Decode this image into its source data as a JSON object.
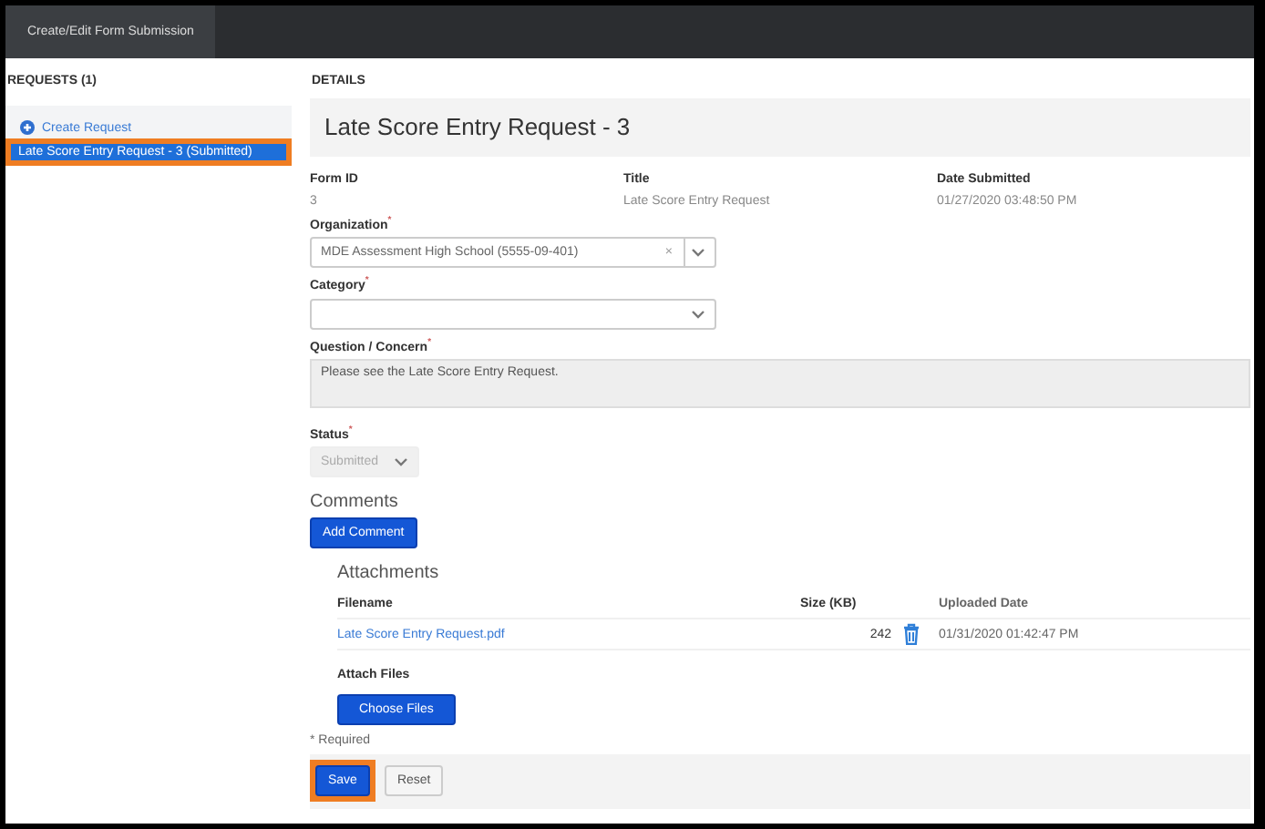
{
  "top_tab": {
    "label": "Create/Edit Form Submission",
    "selected": true
  },
  "requests": {
    "heading": "REQUESTS (1)",
    "create": "Create Request",
    "items": [
      {
        "label": "Late Score Entry Request - 3 (Submitted)",
        "selected": true,
        "highlighted": true
      }
    ]
  },
  "details": {
    "heading": "DETAILS",
    "title": "Late Score Entry Request - 3",
    "info": [
      {
        "label": "Form ID",
        "value": "3"
      },
      {
        "label": "Title",
        "value": "Late Score Entry Request"
      },
      {
        "label": "Date Submitted",
        "value": "01/27/2020 03:48:50 PM"
      }
    ],
    "organization": {
      "label": "Organization$^{*}$",
      "value": "MDE Assessment High School (5555-09-401)",
      "clear": "×"
    },
    "category": {
      "label": "Category$^{*}$"
    },
    "question": {
      "label": "Question / Concern$^{*}$",
      "value": "Please see the Late Score Entry Request.",
      "disabled": true
    },
    "status": {
      "label": "Status$^{*}$",
      "value": "Submitted",
      "disabled": true
    },
    "comments": {
      "heading": "Comments",
      "button": "Add Comment"
    },
    "attachments": {
      "heading": "Attachments",
      "columns": [
        "Filename",
        "Size (KB)",
        "Uploaded Date"
      ],
      "rows": [
        {
          "filename": "Late Score Entry Request.pdf",
          "size": "242",
          "uploaded": "01/31/2020 01:42:47 PM"
        }
      ]
    },
    "attach_files": {
      "label": "Attach Files",
      "button": "Choose Files"
    },
    "required_note": "* Required",
    "buttons": [
      {
        "label": "Save",
        "kind": "primary",
        "highlighted": true
      },
      {
        "label": "Reset",
        "kind": "default",
        "highlighted": false
      }
    ]
  }
}
